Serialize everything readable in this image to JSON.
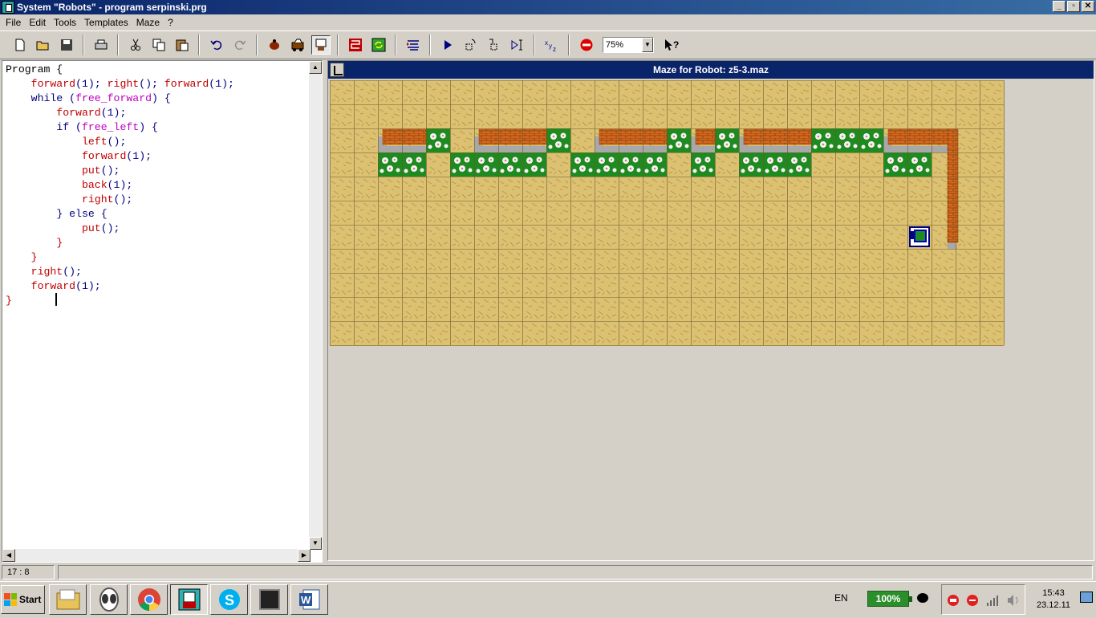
{
  "window": {
    "title": "System \"Robots\" - program serpinski.prg",
    "minimize": "_",
    "maximize": "▫",
    "close": "✕"
  },
  "menu": [
    "File",
    "Edit",
    "Tools",
    "Templates",
    "Maze",
    "?"
  ],
  "toolbar": {
    "zoom_value": "75%"
  },
  "editor": {
    "code_lines": [
      [
        [
          "Program {",
          "black"
        ]
      ],
      [
        [
          "    ",
          "black"
        ],
        [
          "forward",
          "red"
        ],
        [
          "(1); ",
          "blue"
        ],
        [
          "right",
          "red"
        ],
        [
          "(); ",
          "blue"
        ],
        [
          "forward",
          "red"
        ],
        [
          "(1);",
          "blue"
        ]
      ],
      [
        [
          "    ",
          "black"
        ],
        [
          "while",
          "blue"
        ],
        [
          " (",
          "blue"
        ],
        [
          "free_forward",
          "mag"
        ],
        [
          ") {",
          "blue"
        ]
      ],
      [
        [
          "        ",
          "black"
        ],
        [
          "forward",
          "red"
        ],
        [
          "(1);",
          "blue"
        ]
      ],
      [
        [
          "        ",
          "black"
        ],
        [
          "if",
          "blue"
        ],
        [
          " (",
          "blue"
        ],
        [
          "free_left",
          "mag"
        ],
        [
          ") {",
          "blue"
        ]
      ],
      [
        [
          "            ",
          "black"
        ],
        [
          "left",
          "red"
        ],
        [
          "();",
          "blue"
        ]
      ],
      [
        [
          "            ",
          "black"
        ],
        [
          "forward",
          "red"
        ],
        [
          "(1);",
          "blue"
        ]
      ],
      [
        [
          "            ",
          "black"
        ],
        [
          "put",
          "red"
        ],
        [
          "();",
          "blue"
        ]
      ],
      [
        [
          "            ",
          "black"
        ],
        [
          "back",
          "red"
        ],
        [
          "(1);",
          "blue"
        ]
      ],
      [
        [
          "            ",
          "black"
        ],
        [
          "right",
          "red"
        ],
        [
          "();",
          "blue"
        ]
      ],
      [
        [
          "        ",
          "black"
        ],
        [
          "} else {",
          "blue"
        ]
      ],
      [
        [
          "            ",
          "black"
        ],
        [
          "put",
          "red"
        ],
        [
          "();",
          "blue"
        ]
      ],
      [
        [
          "        ",
          "black"
        ],
        [
          "}",
          "red"
        ]
      ],
      [
        [
          "    ",
          "black"
        ],
        [
          "}",
          "red"
        ]
      ],
      [
        [
          "    ",
          "black"
        ],
        [
          "right",
          "red"
        ],
        [
          "();",
          "blue"
        ]
      ],
      [
        [
          "    ",
          "black"
        ],
        [
          "forward",
          "red"
        ],
        [
          "(1);",
          "blue"
        ]
      ],
      [
        [
          "}",
          "red"
        ]
      ]
    ]
  },
  "maze": {
    "title": "Maze for Robot: z5-3.maz",
    "cols": 28,
    "rows": 11,
    "flower_cells": [
      [
        4,
        2
      ],
      [
        9,
        2
      ],
      [
        14,
        2
      ],
      [
        16,
        2
      ],
      [
        20,
        2
      ],
      [
        21,
        2
      ],
      [
        22,
        2
      ],
      [
        2,
        3
      ],
      [
        3,
        3
      ],
      [
        5,
        3
      ],
      [
        6,
        3
      ],
      [
        7,
        3
      ],
      [
        8,
        3
      ],
      [
        10,
        3
      ],
      [
        11,
        3
      ],
      [
        12,
        3
      ],
      [
        13,
        3
      ],
      [
        15,
        3
      ],
      [
        17,
        3
      ],
      [
        18,
        3
      ],
      [
        19,
        3
      ],
      [
        23,
        3
      ],
      [
        24,
        3
      ]
    ],
    "wall_segments": [
      [
        2,
        4
      ],
      [
        6,
        9
      ],
      [
        11,
        14
      ],
      [
        15,
        16
      ],
      [
        17,
        20
      ],
      [
        23,
        26
      ]
    ],
    "robot_cell": [
      24,
      6
    ]
  },
  "status": {
    "position": "17 : 8"
  },
  "taskbar": {
    "start_label": "Start",
    "lang": "EN",
    "battery": "100%",
    "time": "15:43",
    "date": "23.12.11"
  },
  "colors": {
    "code_black": "#000000",
    "code_blue": "#00007f",
    "code_red": "#c00000",
    "code_mag": "#c000c0",
    "sand": "#dcc172",
    "grass": "#1f8a1f",
    "brick": "#d2691e",
    "title_blue": "#0a246a"
  }
}
